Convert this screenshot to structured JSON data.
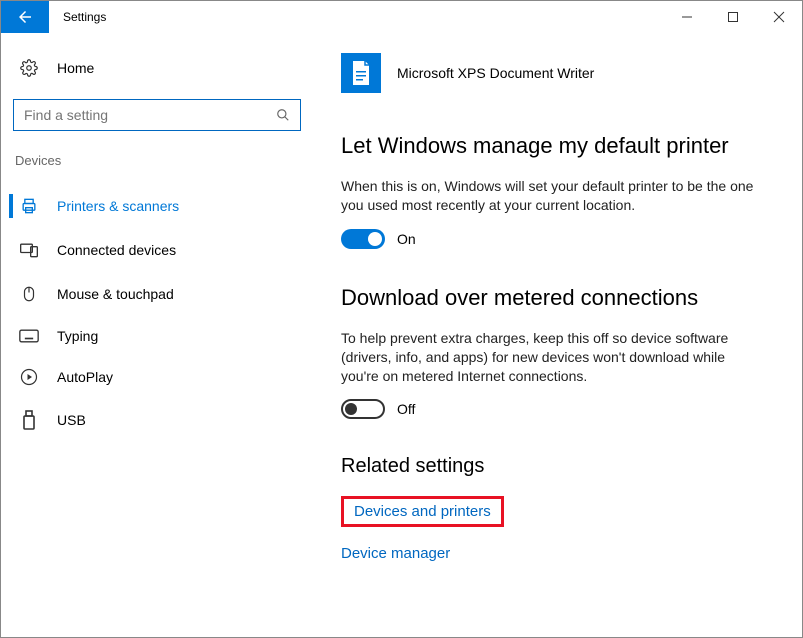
{
  "window": {
    "title": "Settings"
  },
  "sidebar": {
    "home": "Home",
    "search_placeholder": "Find a setting",
    "category": "Devices",
    "items": [
      {
        "label": "Printers & scanners"
      },
      {
        "label": "Connected devices"
      },
      {
        "label": "Mouse & touchpad"
      },
      {
        "label": "Typing"
      },
      {
        "label": "AutoPlay"
      },
      {
        "label": "USB"
      }
    ]
  },
  "main": {
    "printer_name": "Microsoft XPS Document Writer",
    "section1": {
      "title": "Let Windows manage my default printer",
      "desc": "When this is on, Windows will set your default printer to be the one you used most recently at your current location.",
      "toggle_label": "On"
    },
    "section2": {
      "title": "Download over metered connections",
      "desc": "To help prevent extra charges, keep this off so device software (drivers, info, and apps) for new devices won't download while you're on metered Internet connections.",
      "toggle_label": "Off"
    },
    "related": {
      "title": "Related settings",
      "link1": "Devices and printers",
      "link2": "Device manager"
    }
  }
}
